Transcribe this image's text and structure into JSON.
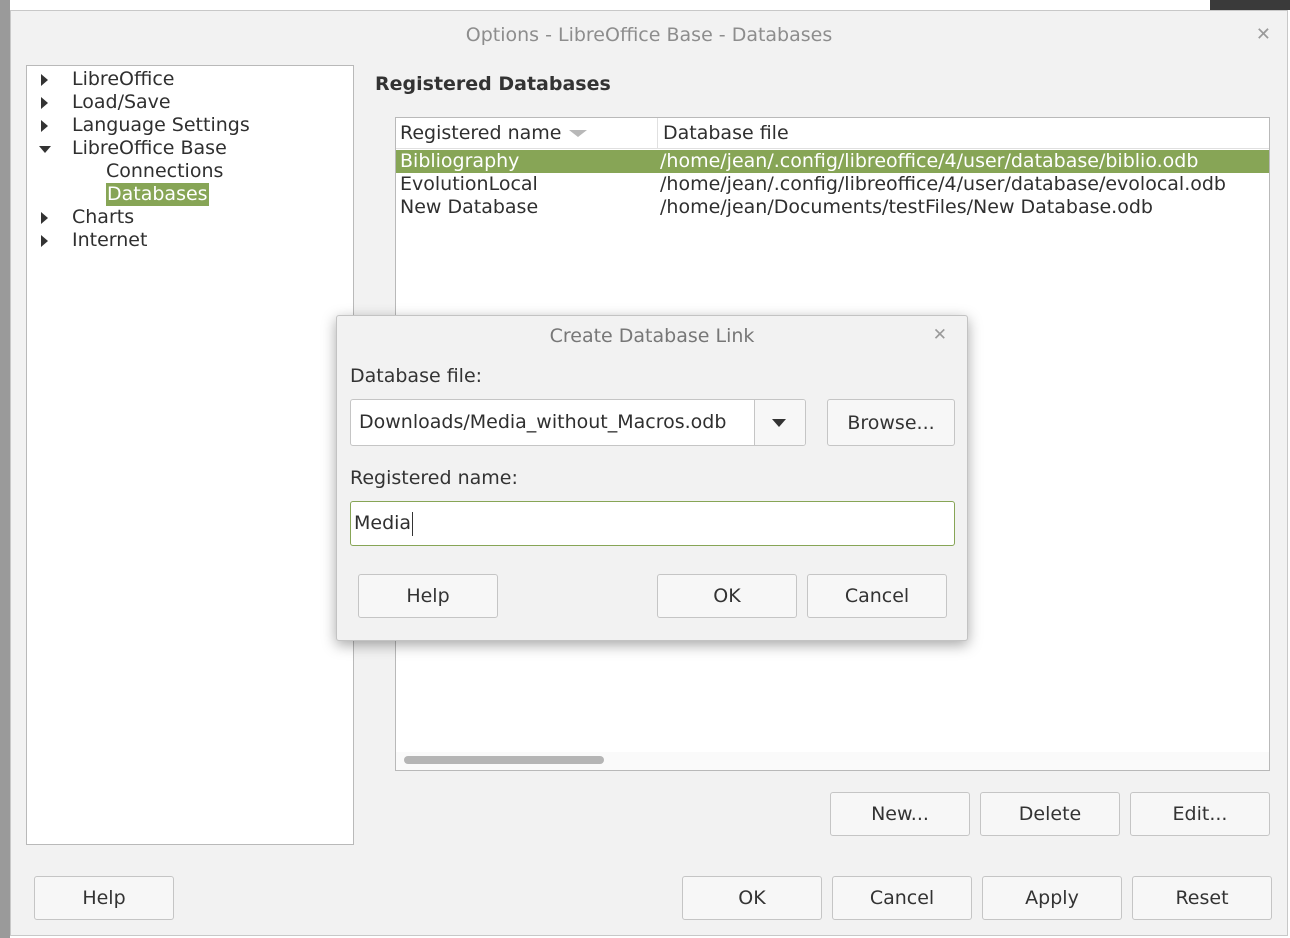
{
  "window": {
    "title": "Options - LibreOffice Base - Databases"
  },
  "tree": {
    "items": [
      {
        "label": "LibreOffice"
      },
      {
        "label": "Load/Save"
      },
      {
        "label": "Language Settings"
      },
      {
        "label": "LibreOffice Base"
      },
      {
        "label": "Connections"
      },
      {
        "label": "Databases"
      },
      {
        "label": "Charts"
      },
      {
        "label": "Internet"
      }
    ]
  },
  "main": {
    "section_title": "Registered Databases",
    "table": {
      "columns": [
        "Registered name",
        "Database file"
      ],
      "rows": [
        {
          "name": "Bibliography",
          "file": "/home/jean/.config/libreoffice/4/user/database/biblio.odb"
        },
        {
          "name": "EvolutionLocal",
          "file": "/home/jean/.config/libreoffice/4/user/database/evolocal.odb"
        },
        {
          "name": "New Database",
          "file": "/home/jean/Documents/testFiles/New Database.odb"
        }
      ]
    },
    "buttons": {
      "new": "New...",
      "delete": "Delete",
      "edit": "Edit..."
    }
  },
  "footer": {
    "help": "Help",
    "ok": "OK",
    "cancel": "Cancel",
    "apply": "Apply",
    "reset": "Reset"
  },
  "dialog": {
    "title": "Create Database Link",
    "file_label": "Database file:",
    "file_value": "Downloads/Media_without_Macros.odb",
    "browse": "Browse...",
    "name_label": "Registered name:",
    "name_value": "Media",
    "help": "Help",
    "ok": "OK",
    "cancel": "Cancel"
  },
  "colors": {
    "accent": "#87a556",
    "window_bg": "#f2f2f2",
    "text": "#2f2f2f"
  }
}
